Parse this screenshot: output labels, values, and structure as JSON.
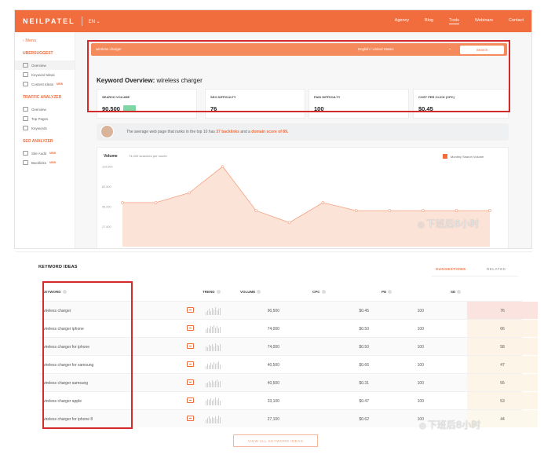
{
  "topbar": {
    "brand": "NEILPATEL",
    "lang": "EN ⌄",
    "nav": [
      "Agency",
      "Blog",
      "Tools",
      "Webinars",
      "Contact"
    ],
    "active_nav_index": 2,
    "brand_color": "#f26d3d"
  },
  "sidebar": {
    "menu_label": "‹  Menu",
    "sections": [
      {
        "title": "UBERSUGGEST",
        "items": [
          {
            "label": "Overview",
            "active": true,
            "badge": ""
          },
          {
            "label": "Keyword Ideas",
            "active": false,
            "badge": ""
          },
          {
            "label": "Content Ideas",
            "active": false,
            "badge": "NEW"
          }
        ]
      },
      {
        "title": "TRAFFIC ANALYZER",
        "items": [
          {
            "label": "Overview",
            "active": false,
            "badge": ""
          },
          {
            "label": "Top Pages",
            "active": false,
            "badge": ""
          },
          {
            "label": "Keywords",
            "active": false,
            "badge": ""
          }
        ]
      },
      {
        "title": "SEO ANALYZER",
        "items": [
          {
            "label": "Site Audit",
            "active": false,
            "badge": "NEW"
          },
          {
            "label": "Backlinks",
            "active": false,
            "badge": "NEW"
          }
        ]
      }
    ]
  },
  "search": {
    "query": "wireless charger",
    "language": "English / United States",
    "button": "Search"
  },
  "overview": {
    "title_prefix": "Keyword Overview:",
    "title_keyword": "wireless charger",
    "metrics": [
      {
        "label": "SEARCH VOLUME",
        "value": "90,500",
        "badge": ""
      },
      {
        "label": "SEO DIFFICULTY",
        "value": "76",
        "badge": ""
      },
      {
        "label": "PAID DIFFICULTY",
        "value": "100",
        "badge": ""
      },
      {
        "label": "COST PER CLICK (CPC)",
        "value": "$0.45",
        "badge": ""
      }
    ],
    "tip_text_1": "The average web page that ranks in the top 10 has",
    "tip_backlinks": "37 backlinks",
    "tip_text_2": "and a",
    "tip_domain": "domain score of 89."
  },
  "chart_data": {
    "type": "area",
    "title": "Volume",
    "subtitle": "74,000 searches per month",
    "legend": "Monthly Search Volume",
    "legend_position": "top-right",
    "ylabels": [
      "110,000",
      "82,500",
      "55,000",
      "27,500"
    ],
    "ylim": [
      0,
      110000
    ],
    "values": [
      60500,
      60500,
      74000,
      110000,
      49500,
      33100,
      60500,
      49500,
      49500,
      49500,
      49500,
      49500
    ],
    "color": "#f26d3d"
  },
  "ideas": {
    "title": "KEYWORD IDEAS",
    "tab_suggestions": "SUGGESTIONS",
    "tab_related": "RELATED",
    "columns": {
      "keyword": "KEYWORD",
      "trend": "TREND",
      "volume": "VOLUME",
      "cpc": "CPC",
      "pd": "PD",
      "sd": "SD"
    },
    "rows": [
      {
        "keyword": "wireless charger",
        "volume": "90,500",
        "cpc": "$0.45",
        "pd": "100",
        "sd": "76",
        "sd_color": "#fbe4e0"
      },
      {
        "keyword": "wireless charger iphone",
        "volume": "74,000",
        "cpc": "$0.50",
        "pd": "100",
        "sd": "66",
        "sd_color": "#fdf3e6"
      },
      {
        "keyword": "wireless charger for iphone",
        "volume": "74,000",
        "cpc": "$0.50",
        "pd": "100",
        "sd": "58",
        "sd_color": "#fdf3e6"
      },
      {
        "keyword": "wireless charger for samsung",
        "volume": "40,500",
        "cpc": "$0.66",
        "pd": "100",
        "sd": "47",
        "sd_color": "#fdf6e8"
      },
      {
        "keyword": "wireless charger samsung",
        "volume": "40,500",
        "cpc": "$0.31",
        "pd": "100",
        "sd": "55",
        "sd_color": "#fdf6e8"
      },
      {
        "keyword": "wireless charger apple",
        "volume": "33,100",
        "cpc": "$0.47",
        "pd": "100",
        "sd": "53",
        "sd_color": "#fdf6e8"
      },
      {
        "keyword": "wireless charger for iphone 8",
        "volume": "27,100",
        "cpc": "$0.62",
        "pd": "100",
        "sd": "44",
        "sd_color": "#fdf8ec"
      }
    ],
    "view_all": "VIEW ALL KEYWORD IDEAS"
  },
  "watermark": "下班后8小时",
  "highlight_color": "#d32a2a"
}
